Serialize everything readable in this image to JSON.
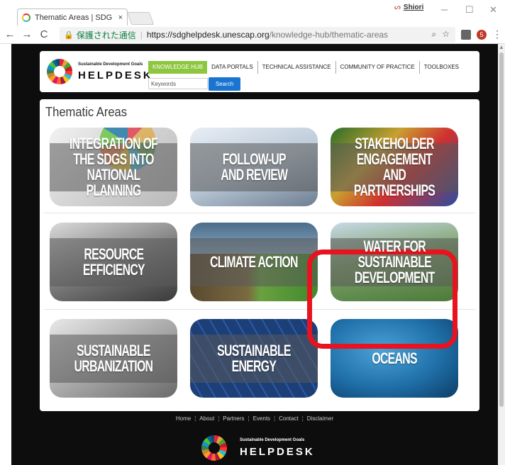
{
  "browser": {
    "tab_title": "Thematic Areas | SDG Hel",
    "tab_close": "×",
    "profile_name": "Shiori",
    "minimize": "─",
    "maximize": "☐",
    "close": "✕",
    "secure_label": "保護された通信",
    "url_host": "https://sdghelpdesk.unescap.org",
    "url_path": "/knowledge-hub/thematic-areas",
    "ext_badge": "5"
  },
  "header": {
    "logo_small": "Sustainable Development Goals",
    "logo_big": "HELPDESK",
    "nav": [
      "KNOWLEDGE HUB",
      "DATA PORTALS",
      "TECHNICAL ASSISTANCE",
      "COMMUNITY OF PRACTICE",
      "TOOLBOXES"
    ],
    "search_placeholder": "Keywords",
    "search_button": "Search"
  },
  "content": {
    "title": "Thematic Areas",
    "tiles": [
      {
        "label": "INTEGRATION OF\nTHE SDGS INTO\nNATIONAL PLANNING"
      },
      {
        "label": "FOLLOW-UP\nAND REVIEW"
      },
      {
        "label": "STAKEHOLDER\nENGAGEMENT AND\nPARTNERSHIPS"
      },
      {
        "label": "RESOURCE\nEFFICIENCY"
      },
      {
        "label": "CLIMATE ACTION"
      },
      {
        "label": "WATER FOR\nSUSTAINABLE\nDEVELOPMENT"
      },
      {
        "label": "SUSTAINABLE\nURBANIZATION"
      },
      {
        "label": "SUSTAINABLE\nENERGY"
      },
      {
        "label": "OCEANS"
      }
    ]
  },
  "footer": {
    "links": [
      "Home",
      "About",
      "Partners",
      "Events",
      "Contact",
      "Disclaimer"
    ],
    "logo_small": "Sustainable Development Goals",
    "logo_big": "HELPDESK"
  },
  "colors": {
    "nav_active": "#8dc63f",
    "search_button": "#1a75d1",
    "highlight": "#e8131e",
    "page_background": "#0d0d0d"
  }
}
